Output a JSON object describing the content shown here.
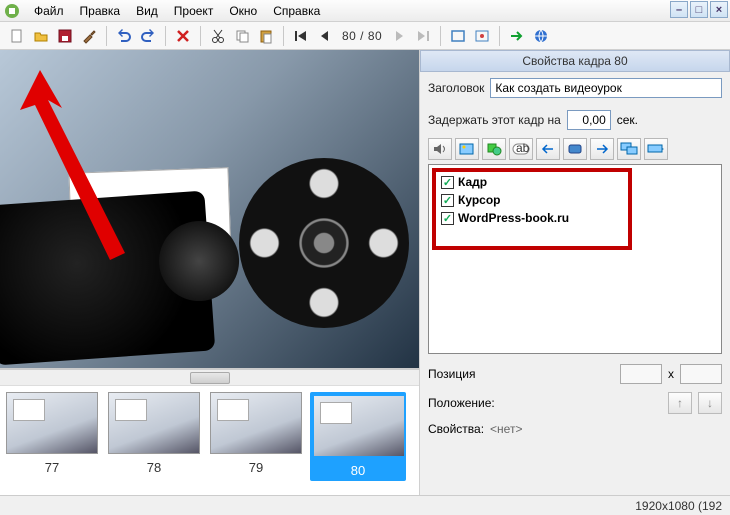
{
  "menu": {
    "file": "Файл",
    "edit": "Правка",
    "view": "Вид",
    "project": "Проект",
    "window": "Окно",
    "help": "Справка"
  },
  "toolbar": {
    "new": "new-file",
    "open": "open-file",
    "save": "save-file",
    "tool": "tool",
    "undo": "undo",
    "redo": "redo",
    "delete": "delete",
    "cut": "cut",
    "copy": "copy",
    "paste": "paste",
    "first": "first-frame",
    "prev": "prev-frame",
    "next": "next-frame",
    "last": "last-frame",
    "frame_counter": "80 / 80",
    "fullscreen": "fullscreen",
    "export": "export",
    "go": "go",
    "web": "web"
  },
  "panel": {
    "title": "Свойства кадра 80",
    "header_label": "Заголовок",
    "header_value": "Как создать видеоурок",
    "delay_label": "Задержать этот кадр на",
    "delay_value": "0,00",
    "delay_unit": "сек."
  },
  "layers": {
    "items": [
      {
        "checked": true,
        "label": "Кадр"
      },
      {
        "checked": true,
        "label": "Курсор"
      },
      {
        "checked": true,
        "label": "WordPress-book.ru"
      }
    ]
  },
  "props": {
    "position_label": "Позиция",
    "x_sep": "x",
    "align_label": "Положение:",
    "props_label": "Свойства:",
    "props_value": "<нет>"
  },
  "thumbs": {
    "items": [
      {
        "num": "77",
        "selected": false
      },
      {
        "num": "78",
        "selected": false
      },
      {
        "num": "79",
        "selected": false
      },
      {
        "num": "80",
        "selected": true
      }
    ]
  },
  "status": {
    "dimensions": "1920x1080 (192"
  }
}
